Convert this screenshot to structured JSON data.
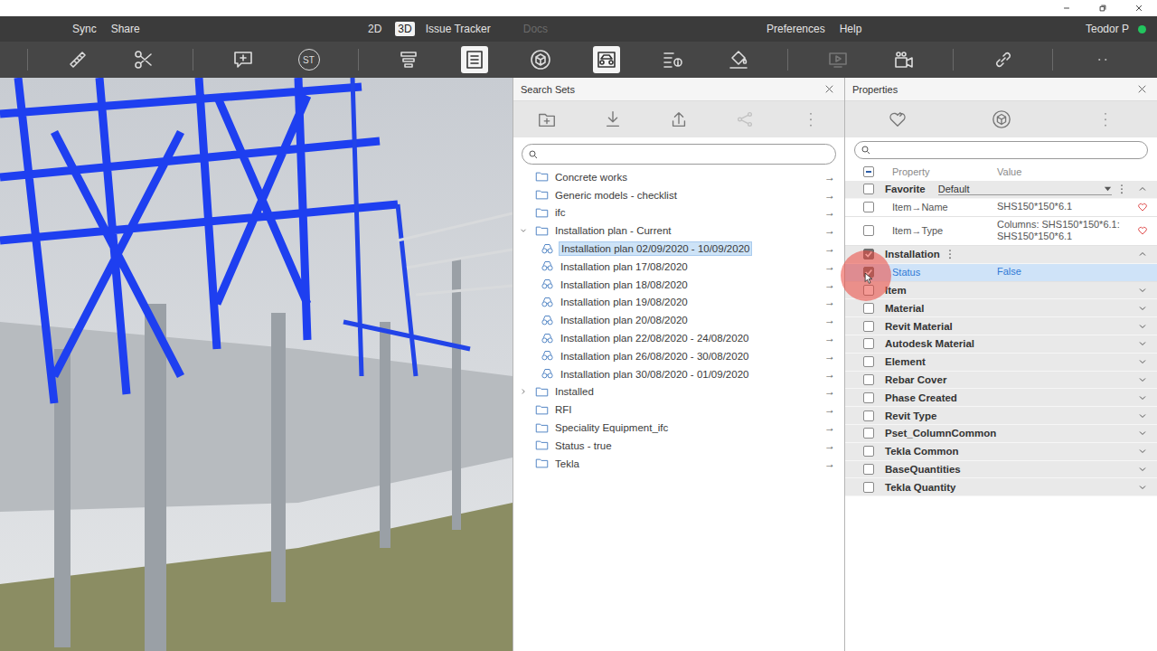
{
  "menubar": {
    "left": [
      "Sync",
      "Share"
    ],
    "views": [
      {
        "label": "2D",
        "selected": false
      },
      {
        "label": "3D",
        "selected": true
      }
    ],
    "center": [
      {
        "label": "Issue Tracker",
        "disabled": false
      },
      {
        "label": "Docs",
        "disabled": true
      }
    ],
    "right": [
      "Preferences",
      "Help"
    ],
    "user": {
      "name": "Teodor P",
      "online": true
    }
  },
  "toolbar": {
    "groups": [
      [
        {
          "kind": "ruler",
          "selected": false,
          "disabled": false
        },
        {
          "kind": "scissors",
          "selected": false,
          "disabled": false
        }
      ],
      [
        {
          "kind": "comment",
          "selected": false,
          "disabled": false
        },
        {
          "kind": "st",
          "label": "ST",
          "selected": false,
          "disabled": false
        }
      ],
      [
        {
          "kind": "layers",
          "selected": false,
          "disabled": false
        },
        {
          "kind": "list",
          "selected": true,
          "disabled": false
        },
        {
          "kind": "cube",
          "selected": false,
          "disabled": false
        },
        {
          "kind": "appearance",
          "selected": true,
          "disabled": false
        },
        {
          "kind": "list-info",
          "selected": false,
          "disabled": false
        },
        {
          "kind": "paint",
          "selected": false,
          "disabled": false
        }
      ],
      [
        {
          "kind": "video",
          "selected": false,
          "disabled": true
        },
        {
          "kind": "camera",
          "selected": false,
          "disabled": false
        }
      ],
      [
        {
          "kind": "link",
          "selected": false,
          "disabled": false
        }
      ],
      [
        {
          "kind": "more-h",
          "selected": false,
          "disabled": false
        }
      ]
    ]
  },
  "search_sets": {
    "title": "Search Sets",
    "toolbar": [
      {
        "kind": "folder-add",
        "disabled": false
      },
      {
        "kind": "download",
        "disabled": false
      },
      {
        "kind": "upload",
        "disabled": false
      },
      {
        "kind": "share",
        "disabled": true
      },
      {
        "kind": "more-v",
        "disabled": false
      }
    ],
    "search": {
      "placeholder": ""
    },
    "item_arrow": "→",
    "items": [
      {
        "kind": "folder",
        "label": "Concrete works",
        "level": 0,
        "expandable": false,
        "expanded": false,
        "selected": false
      },
      {
        "kind": "folder",
        "label": "Generic models - checklist",
        "level": 0,
        "expandable": false,
        "expanded": false,
        "selected": false
      },
      {
        "kind": "folder",
        "label": "ifc",
        "level": 0,
        "expandable": false,
        "expanded": false,
        "selected": false
      },
      {
        "kind": "folder",
        "label": "Installation plan - Current",
        "level": 0,
        "expandable": true,
        "expanded": true,
        "selected": false
      },
      {
        "kind": "set",
        "label": "Installation plan 02/09/2020 - 10/09/2020",
        "level": 1,
        "expandable": false,
        "expanded": false,
        "selected": true
      },
      {
        "kind": "set",
        "label": "Installation plan 17/08/2020",
        "level": 1,
        "expandable": false,
        "expanded": false,
        "selected": false
      },
      {
        "kind": "set",
        "label": "Installation plan 18/08/2020",
        "level": 1,
        "expandable": false,
        "expanded": false,
        "selected": false
      },
      {
        "kind": "set",
        "label": "Installation plan 19/08/2020",
        "level": 1,
        "expandable": false,
        "expanded": false,
        "selected": false
      },
      {
        "kind": "set",
        "label": "Installation plan 20/08/2020",
        "level": 1,
        "expandable": false,
        "expanded": false,
        "selected": false
      },
      {
        "kind": "set",
        "label": "Installation plan 22/08/2020 - 24/08/2020",
        "level": 1,
        "expandable": false,
        "expanded": false,
        "selected": false
      },
      {
        "kind": "set",
        "label": "Installation plan 26/08/2020 - 30/08/2020",
        "level": 1,
        "expandable": false,
        "expanded": false,
        "selected": false
      },
      {
        "kind": "set",
        "label": "Installation plan 30/08/2020 - 01/09/2020",
        "level": 1,
        "expandable": false,
        "expanded": false,
        "selected": false
      },
      {
        "kind": "folder",
        "label": "Installed",
        "level": 0,
        "expandable": true,
        "expanded": false,
        "selected": false
      },
      {
        "kind": "folder",
        "label": "RFI",
        "level": 0,
        "expandable": false,
        "expanded": false,
        "selected": false
      },
      {
        "kind": "folder",
        "label": "Speciality Equipment_ifc",
        "level": 0,
        "expandable": false,
        "expanded": false,
        "selected": false
      },
      {
        "kind": "folder",
        "label": "Status - true",
        "level": 0,
        "expandable": false,
        "expanded": false,
        "selected": false
      },
      {
        "kind": "folder",
        "label": "Tekla",
        "level": 0,
        "expandable": false,
        "expanded": false,
        "selected": false
      }
    ]
  },
  "properties": {
    "title": "Properties",
    "toolbar": [
      {
        "kind": "favorite"
      },
      {
        "kind": "cube"
      },
      {
        "kind": "more-v"
      }
    ],
    "search": {
      "placeholder": ""
    },
    "columns": [
      "Property",
      "Value"
    ],
    "header_checkbox": {
      "checked": false,
      "indeterminate": true
    },
    "rows": [
      {
        "kind": "group",
        "label": "Favorite",
        "checked": false,
        "expanded": true,
        "selected": false,
        "dropdown": "Default",
        "has_menu": true
      },
      {
        "kind": "property",
        "label": "Item→Name",
        "value": "SHS150*150*6.1",
        "checked": false,
        "selected": false,
        "favorite": true
      },
      {
        "kind": "property",
        "label": "Item→Type",
        "value": "Columns: SHS150*150*6.1: SHS150*150*6.1",
        "checked": false,
        "selected": false,
        "favorite": true
      },
      {
        "kind": "group",
        "label": "Installation",
        "checked": true,
        "expanded": true,
        "selected": false,
        "dropdown": "",
        "has_menu": true
      },
      {
        "kind": "property",
        "label": "Status",
        "value": "False",
        "checked": true,
        "selected": true,
        "favorite": false
      },
      {
        "kind": "group",
        "label": "Item",
        "checked": false,
        "expanded": false,
        "selected": false,
        "dropdown": "",
        "has_menu": false
      },
      {
        "kind": "group",
        "label": "Material",
        "checked": false,
        "expanded": false,
        "selected": false,
        "dropdown": "",
        "has_menu": false
      },
      {
        "kind": "group",
        "label": "Revit Material",
        "checked": false,
        "expanded": false,
        "selected": false,
        "dropdown": "",
        "has_menu": false
      },
      {
        "kind": "group",
        "label": "Autodesk Material",
        "checked": false,
        "expanded": false,
        "selected": false,
        "dropdown": "",
        "has_menu": false
      },
      {
        "kind": "group",
        "label": "Element",
        "checked": false,
        "expanded": false,
        "selected": false,
        "dropdown": "",
        "has_menu": false
      },
      {
        "kind": "group",
        "label": "Rebar Cover",
        "checked": false,
        "expanded": false,
        "selected": false,
        "dropdown": "",
        "has_menu": false
      },
      {
        "kind": "group",
        "label": "Phase Created",
        "checked": false,
        "expanded": false,
        "selected": false,
        "dropdown": "",
        "has_menu": false
      },
      {
        "kind": "group",
        "label": "Revit Type",
        "checked": false,
        "expanded": false,
        "selected": false,
        "dropdown": "",
        "has_menu": false
      },
      {
        "kind": "group",
        "label": "Pset_ColumnCommon",
        "checked": false,
        "expanded": false,
        "selected": false,
        "dropdown": "",
        "has_menu": false
      },
      {
        "kind": "group",
        "label": "Tekla Common",
        "checked": false,
        "expanded": false,
        "selected": false,
        "dropdown": "",
        "has_menu": false
      },
      {
        "kind": "group",
        "label": "BaseQuantities",
        "checked": false,
        "expanded": false,
        "selected": false,
        "dropdown": "",
        "has_menu": false
      },
      {
        "kind": "group",
        "label": "Tekla Quantity",
        "checked": false,
        "expanded": false,
        "selected": false,
        "dropdown": "",
        "has_menu": false
      }
    ]
  },
  "click_indicator": {
    "visible": true
  }
}
